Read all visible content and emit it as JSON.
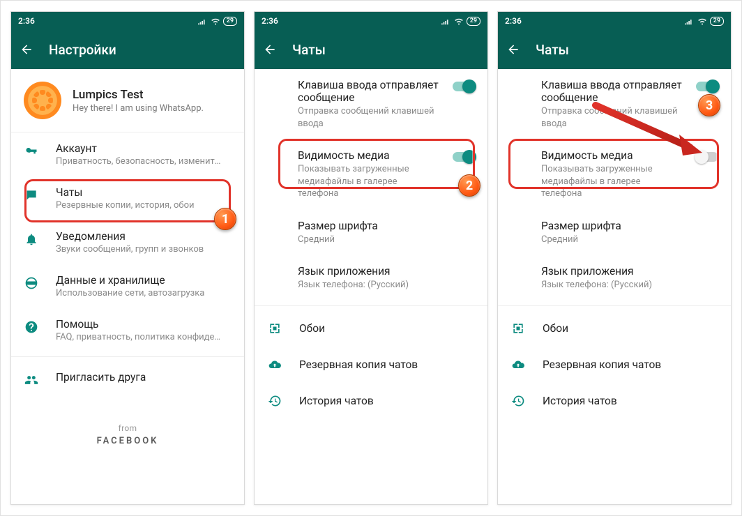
{
  "statusbar": {
    "time": "2:36",
    "battery": "29"
  },
  "appbars": {
    "settings": "Настройки",
    "chats": "Чаты"
  },
  "profile": {
    "name": "Lumpics Test",
    "status": "Hey there! I am using WhatsApp."
  },
  "settingsList": {
    "account": {
      "title": "Аккаунт",
      "sub": "Приватность, безопасность, изменить номер"
    },
    "chats": {
      "title": "Чаты",
      "sub": "Резервные копии, история, обои"
    },
    "notifications": {
      "title": "Уведомления",
      "sub": "Звуки сообщений, групп и звонков"
    },
    "data": {
      "title": "Данные и хранилище",
      "sub": "Использование сети, автозагрузка"
    },
    "help": {
      "title": "Помощь",
      "sub": "FAQ, приватность, политика конфиденциальн…"
    },
    "invite": {
      "title": "Пригласить друга"
    }
  },
  "footer": {
    "from": "from",
    "facebook": "FACEBOOK"
  },
  "chatSettings": {
    "enterSends": {
      "title": "Клавиша ввода отправляет сообщение",
      "sub": "Отправка сообщений клавишей ввода"
    },
    "mediaVis": {
      "title": "Видимость медиа",
      "sub": "Показывать загруженные медиафайлы в галерее телефона"
    },
    "fontSize": {
      "title": "Размер шрифта",
      "sub": "Средний"
    },
    "appLang": {
      "title": "Язык приложения",
      "sub": "Язык телефона: (Русский)"
    },
    "wallpaper": "Обои",
    "backup": "Резервная копия чатов",
    "history": "История чатов"
  },
  "callouts": {
    "one": "1",
    "two": "2",
    "three": "3"
  }
}
